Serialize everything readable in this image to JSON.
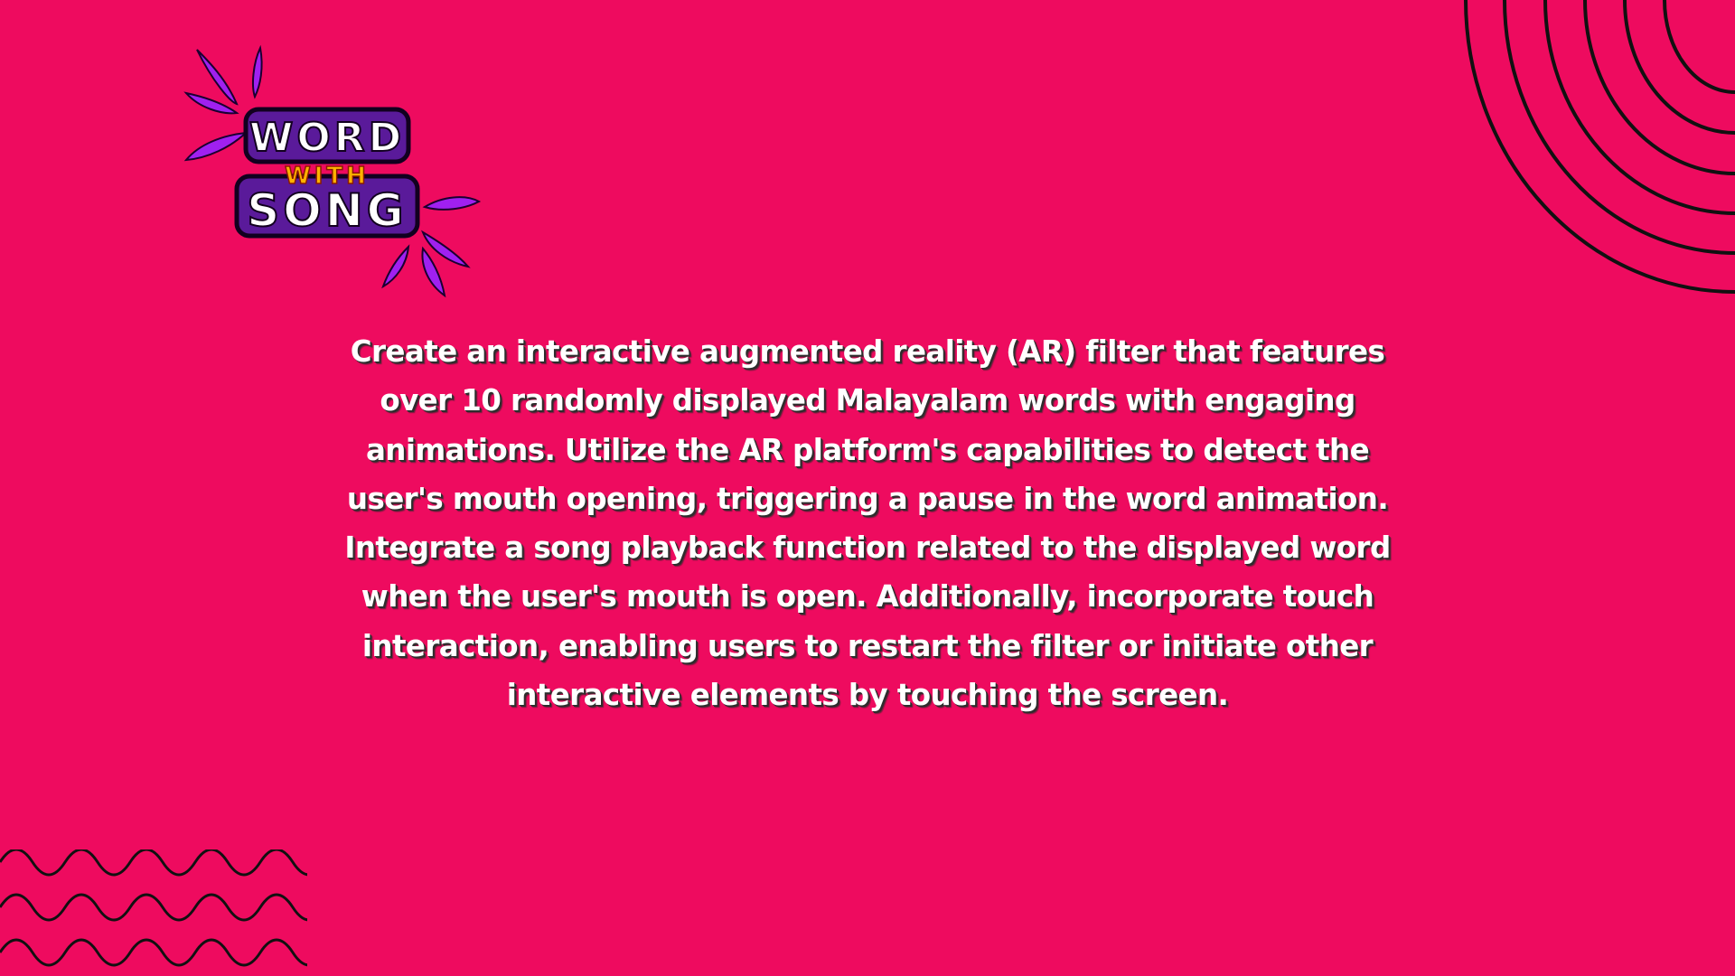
{
  "logo": {
    "word_line": "WORD",
    "with_line": "WITH",
    "song_line": "SONG",
    "icon": "word-with-song-logo"
  },
  "description": "Create an interactive augmented reality (AR) filter that features over 10 randomly displayed Malayalam words with engaging animations. Utilize the AR platform's capabilities to detect the user's mouth opening, triggering a pause in the word animation. Integrate a song playback function related to the displayed word when the user's mouth is open. Additionally, incorporate touch interaction, enabling users to restart the filter or initiate other interactive elements by touching the screen.",
  "colors": {
    "background": "#ee0b5f",
    "text": "#ffffff",
    "decoration": "#111111",
    "logo_purple": "#5a1a9a",
    "logo_accent": "#a020f0",
    "logo_yellow": "#ffb300"
  }
}
